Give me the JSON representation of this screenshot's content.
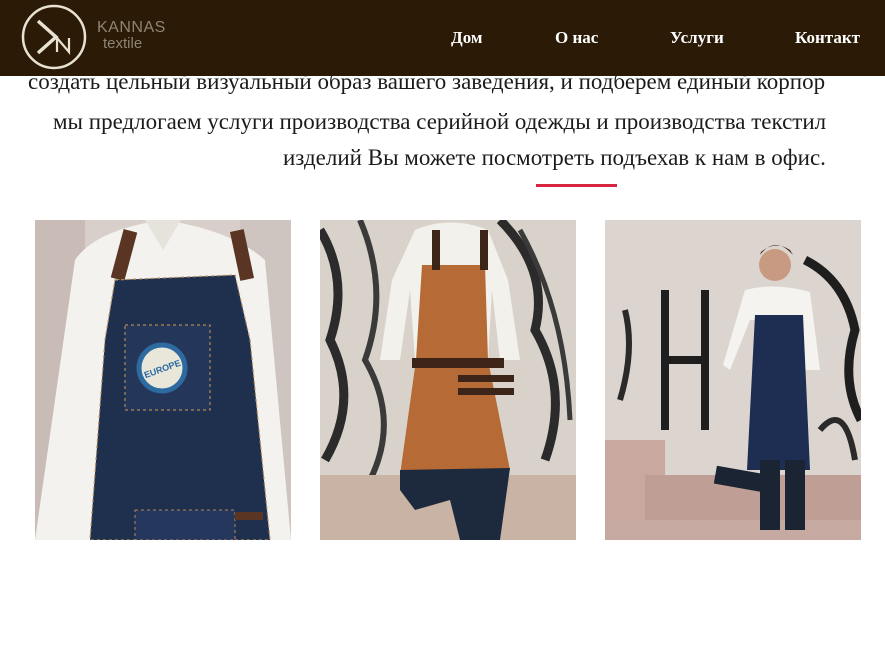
{
  "brand": {
    "line1": "KANNAS",
    "line2": "textile"
  },
  "nav": [
    {
      "label": "Дом"
    },
    {
      "label": "О нас"
    },
    {
      "label": "Услуги"
    },
    {
      "label": "Контакт"
    }
  ],
  "content": {
    "lines": [
      "создать цельный визуальный образ вашего заведения, и подберем единый корпор",
      "мы предлогаем услуги производства серийной одежды и производства текстил",
      "изделий Вы можете посмотреть подъехав к нам в офис."
    ]
  },
  "gallery": {
    "items": [
      {
        "name": "denim-apron-closeup",
        "apron_color": "#1f2f4e",
        "badge_text": "EUROPE"
      },
      {
        "name": "leather-apron",
        "apron_color": "#b66a35"
      },
      {
        "name": "denim-apron-full",
        "apron_color": "#1d2e52"
      }
    ]
  },
  "colors": {
    "header_bg": "#2a1a06",
    "accent": "#d7263d"
  }
}
